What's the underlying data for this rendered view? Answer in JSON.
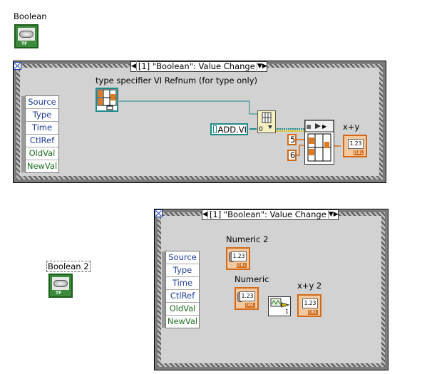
{
  "top": {
    "boolean_label": "Boolean",
    "event_case": {
      "selector_text": "[1] \"Boolean\": Value Change",
      "fields": [
        "Source",
        "Type",
        "Time",
        "CtlRef",
        "OldVal",
        "NewVal"
      ],
      "type_specifier_label": "type specifier VI Refnum (for type only)",
      "vi_path": "ADD.VI",
      "const_x": "5",
      "const_y": "6",
      "indicator_label": "x+y",
      "indicator_value": "1.23"
    }
  },
  "bottom": {
    "boolean_label": "Boolean 2",
    "event_case": {
      "selector_text": "[1] \"Boolean\": Value Change",
      "fields": [
        "Source",
        "Type",
        "Time",
        "CtlRef",
        "OldVal",
        "NewVal"
      ],
      "numeric2_label": "Numeric 2",
      "numeric_label": "Numeric",
      "indicator_label": "x+y 2",
      "control_value": "1.23",
      "indicator_value": "1.23",
      "subvi_const": "1"
    }
  },
  "colors": {
    "boolean_green": "#3c8a3c",
    "numeric_orange": "#d26a18",
    "refnum_teal": "#1f8a8a",
    "event_frame_gray": "#7c7c7c"
  }
}
